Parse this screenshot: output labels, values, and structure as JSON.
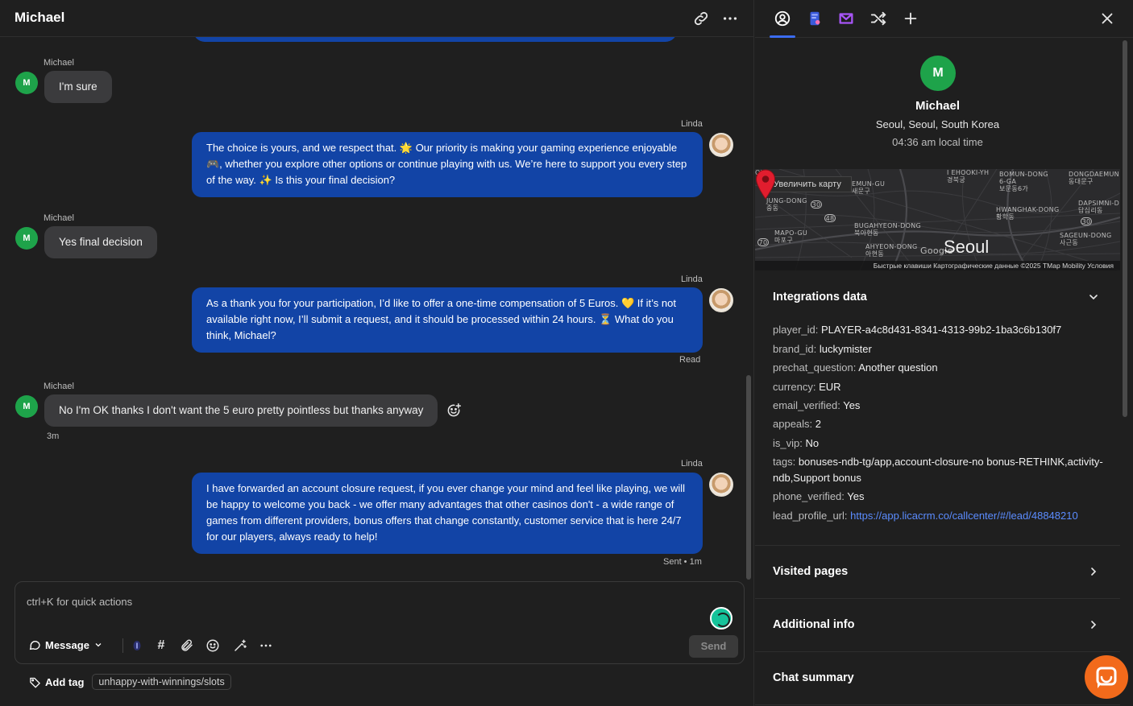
{
  "chat": {
    "title": "Michael",
    "messages": [
      {
        "sender": "Michael",
        "text": "I'm sure"
      },
      {
        "sender": "Linda",
        "text": "The choice is yours, and we respect that. 🌟 Our priority is making your gaming experience enjoyable 🎮, whether you explore other options or continue playing with us. We’re here to support you every step of the way. ✨ Is this your final decision?"
      },
      {
        "sender": "Michael",
        "text": "Yes final decision"
      },
      {
        "sender": "Linda",
        "text": "As a thank you for your participation, I’d like to offer a one-time compensation of 5 Euros. 💛 If it’s not available right now, I’ll submit a request, and it should be processed within 24 hours. ⏳ What do you think, Michael?",
        "status": "Read"
      },
      {
        "sender": "Michael",
        "text": "No I'm OK thanks I don't want the 5 euro pretty pointless but thanks anyway",
        "time": "3m"
      },
      {
        "sender": "Linda",
        "text": "I have forwarded an account closure request, if you ever change your mind and feel like playing, we will be happy to welcome you back - we offer many advantages that other casinos don't - a wide range of games from different providers, bonus offers that change constantly, customer service that is here 24/7 for our players, always ready to help!",
        "status": "Sent • 1m"
      }
    ],
    "avatar_initial": "M"
  },
  "composer": {
    "placeholder": "ctrl+K for quick actions",
    "message_type": "Message",
    "send_label": "Send",
    "add_tag_label": "Add tag",
    "tag": "unhappy-with-winnings/slots"
  },
  "profile": {
    "initial": "M",
    "name": "Michael",
    "location": "Seoul, Seoul, South Korea",
    "local_time": "04:36 am local time"
  },
  "map": {
    "zoom_label": "Увеличить карту",
    "city": "Seoul",
    "footer": "Быстрые клавиши    Картографические данные ©2025 TMap Mobility    Условия",
    "labels": {
      "l0": "OU",
      "l1": "EMUN-GU\n새문구",
      "l2": "JUNG-DONG\n중동",
      "l3": "MAPO-GU\n마포구",
      "l4": "BUGAHYEON-DONG\n북아현동",
      "l5": "AHYEON-DONG\n아현동",
      "l6": "BOMUN-DONG\n6-GA\n보문동6가",
      "l7": "DONGDAEMUN\n동대문구",
      "l8": "HWANGHAK-DONG\n황학동",
      "l9": "DAPSIMNI-D\n답십리동",
      "l10": "SAGEUN-DONG\n사근동",
      "l11": "I EHOOKI-YH\n경북궁",
      "l12": "Google"
    },
    "road_shields": {
      "r1": "30",
      "r2": "48",
      "r3": "70",
      "r4": "30"
    }
  },
  "integrations": {
    "title": "Integrations data",
    "fields": [
      {
        "key": "player_id:",
        "value": "PLAYER-a4c8d431-8341-4313-99b2-1ba3c6b130f7"
      },
      {
        "key": "brand_id:",
        "value": "luckymister"
      },
      {
        "key": "prechat_question:",
        "value": "Another question"
      },
      {
        "key": "currency:",
        "value": "EUR"
      },
      {
        "key": "email_verified:",
        "value": "Yes"
      },
      {
        "key": "appeals:",
        "value": "2"
      },
      {
        "key": "is_vip:",
        "value": "No"
      },
      {
        "key": "tags:",
        "value": "bonuses-ndb-tg/app,account-closure-no bonus-RETHINK,activity-ndb,Support bonus"
      },
      {
        "key": "phone_verified:",
        "value": "Yes"
      },
      {
        "key": "lead_profile_url:",
        "value": "https://app.licacrm.co/callcenter/#/lead/48848210"
      }
    ]
  },
  "sections": {
    "visited_pages": "Visited pages",
    "additional_info": "Additional info",
    "chat_summary": "Chat summary"
  },
  "colors": {
    "outgoing_bubble": "#1244a6",
    "incoming_bubble": "#3b3b3d",
    "customer_avatar": "#1ea34a",
    "link": "#5b8cff",
    "widget": "#f26a1b"
  }
}
